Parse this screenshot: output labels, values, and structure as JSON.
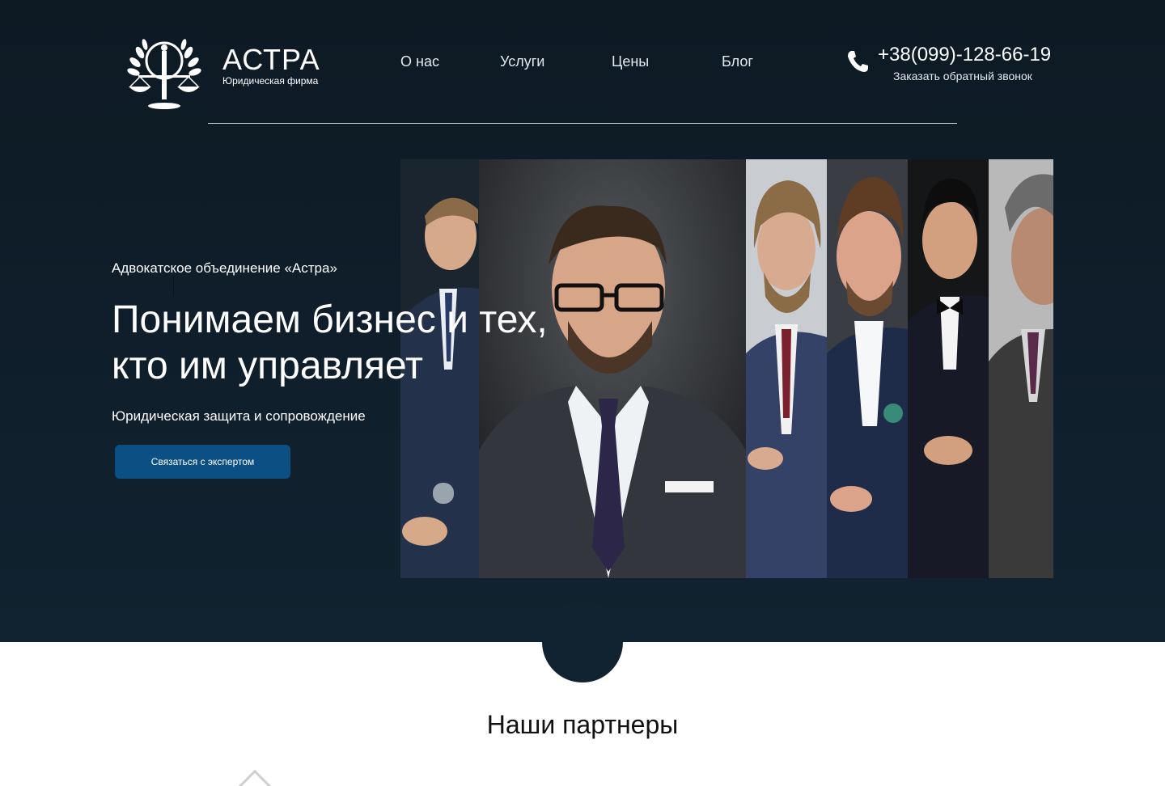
{
  "header": {
    "brand_name": "АСТРА",
    "brand_sub": "Юридическая фирма",
    "logo_icon": "scales-of-justice-icon",
    "nav": [
      {
        "label": "О нас"
      },
      {
        "label": "Услуги"
      },
      {
        "label": "Цены"
      },
      {
        "label": "Блог"
      }
    ],
    "phone_icon": "phone-icon",
    "phone": "+38(099)-128-66-19",
    "callback": "Заказать обратный звонок"
  },
  "hero": {
    "eyebrow": "Адвокатское объединение «Астра»",
    "headline_line1": "Понимаем бизнес и тех,",
    "headline_line2": "кто им управляет",
    "subhead": "Юридическая защита и сопровождение",
    "cta_label": "Связаться с экспертом",
    "photos": [
      "lawyer-portrait-1",
      "lawyer-portrait-2",
      "lawyer-portrait-3",
      "lawyer-portrait-4",
      "lawyer-portrait-5",
      "lawyer-portrait-6"
    ]
  },
  "partners": {
    "title": "Наши партнеры"
  },
  "colors": {
    "hero_bg": "#112230",
    "accent_button": "#0c4f82",
    "text_light": "#ffffff",
    "section_title": "#111111"
  }
}
